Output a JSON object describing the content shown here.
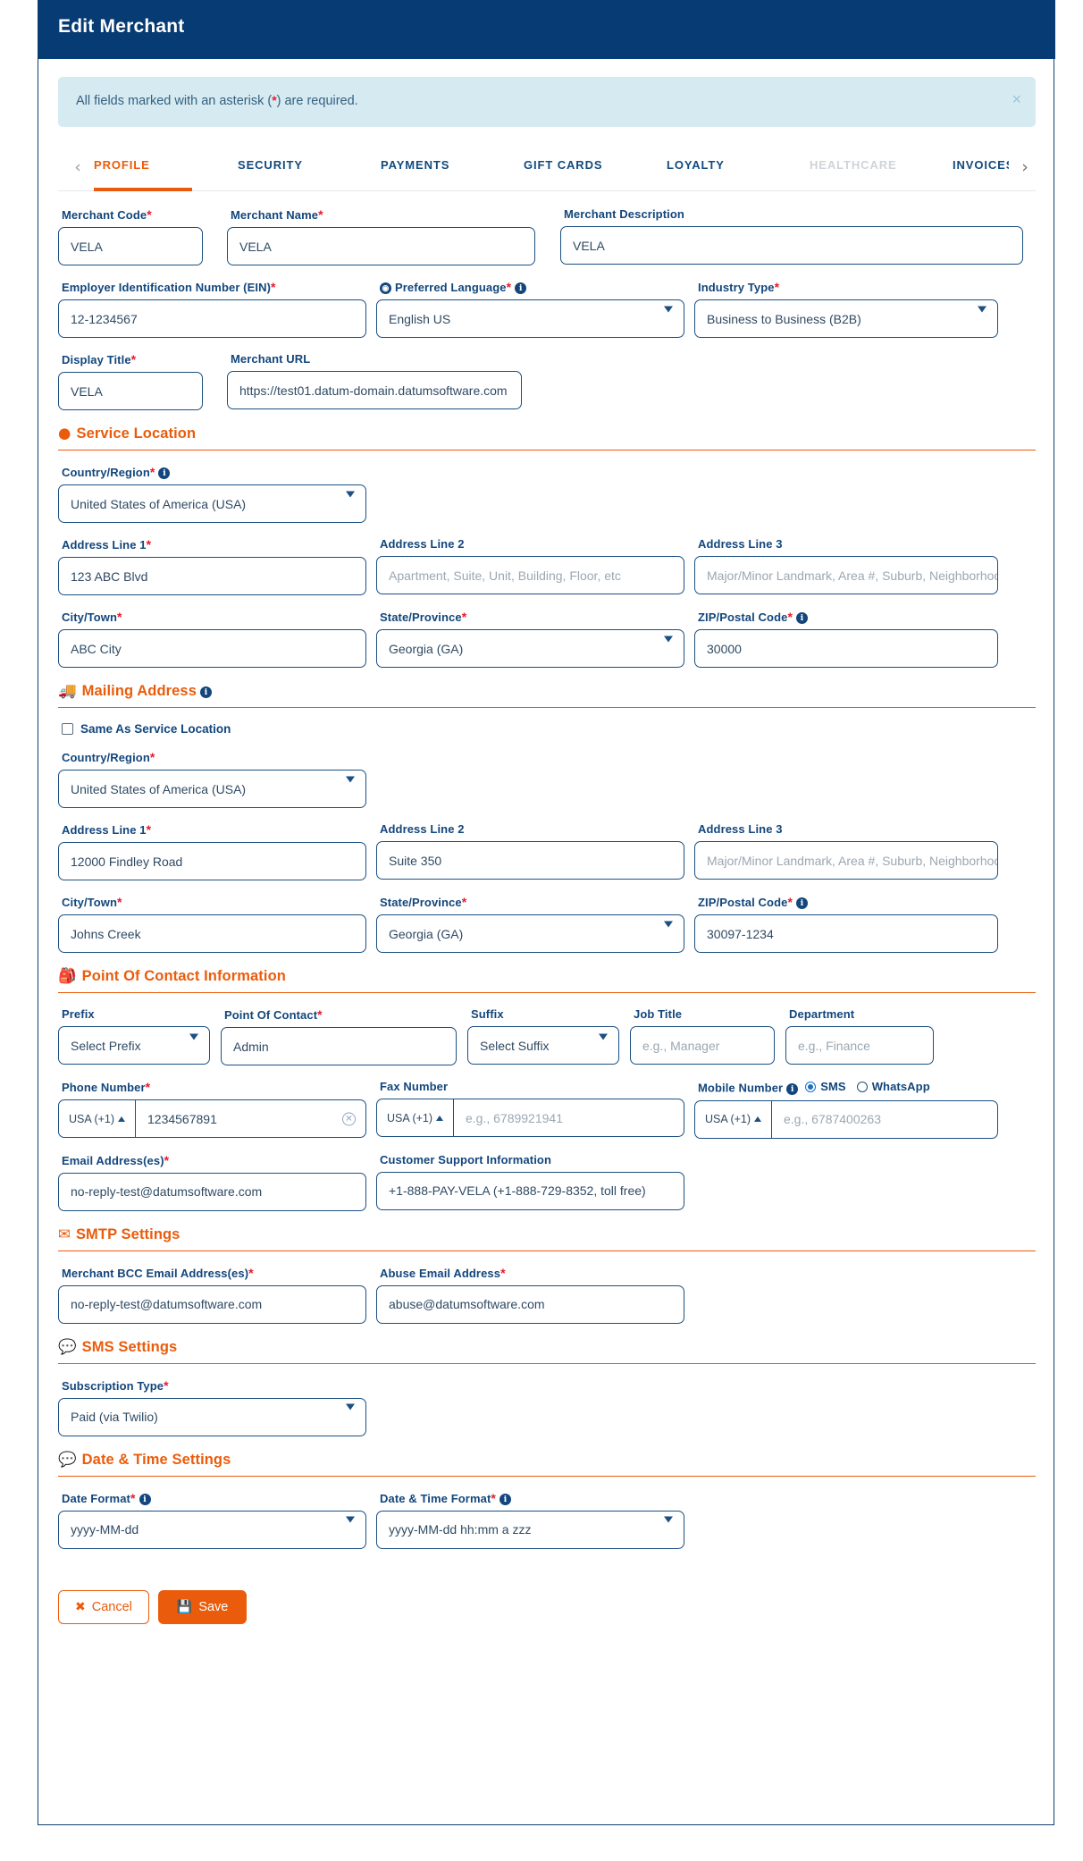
{
  "modal": {
    "title": "Edit Merchant",
    "alert": {
      "text_before": "All fields marked with an asterisk (",
      "asterisk": "*",
      "text_after": ") are required.",
      "close": "×"
    }
  },
  "tabs": {
    "prev_arrow": "‹",
    "next_arrow": "›",
    "items": [
      {
        "label": "PROFILE",
        "state": "active"
      },
      {
        "label": "SECURITY",
        "state": "normal"
      },
      {
        "label": "PAYMENTS",
        "state": "normal"
      },
      {
        "label": "GIFT CARDS",
        "state": "normal"
      },
      {
        "label": "LOYALTY",
        "state": "normal"
      },
      {
        "label": "HEALTHCARE",
        "state": "disabled"
      },
      {
        "label": "INVOICES",
        "state": "normal"
      }
    ]
  },
  "form": {
    "merchant_code": {
      "label": "Merchant Code",
      "required": true,
      "value": "VELA"
    },
    "merchant_name": {
      "label": "Merchant Name",
      "required": true,
      "value": "VELA"
    },
    "merchant_description": {
      "label": "Merchant Description",
      "required": false,
      "value": "VELA"
    },
    "ein": {
      "label": "Employer Identification Number (EIN)",
      "required": true,
      "value": "12-1234567"
    },
    "preferred_language": {
      "label": "Preferred Language",
      "required": true,
      "value": "English US",
      "has_info": true,
      "has_globe": true
    },
    "industry_type": {
      "label": "Industry Type",
      "required": true,
      "value": "Business to Business (B2B)"
    },
    "display_title": {
      "label": "Display Title",
      "required": true,
      "value": "VELA"
    },
    "merchant_url": {
      "label": "Merchant URL",
      "required": false,
      "value": "https://test01.datum-domain.datumsoftware.com"
    }
  },
  "service_location": {
    "heading": "Service Location",
    "icon": "map-pin-icon",
    "country": {
      "label": "Country/Region",
      "required": true,
      "has_info": true,
      "value": "United States of America (USA)"
    },
    "address1": {
      "label": "Address Line 1",
      "required": true,
      "value": "123 ABC Blvd"
    },
    "address2": {
      "label": "Address Line 2",
      "required": false,
      "value": "",
      "placeholder": "Apartment, Suite, Unit, Building, Floor, etc"
    },
    "address3": {
      "label": "Address Line 3",
      "required": false,
      "value": "",
      "placeholder": "Major/Minor Landmark, Area #, Suburb, Neighborhood"
    },
    "city": {
      "label": "City/Town",
      "required": true,
      "value": "ABC City"
    },
    "state": {
      "label": "State/Province",
      "required": true,
      "value": "Georgia (GA)"
    },
    "zip": {
      "label": "ZIP/Postal Code",
      "required": true,
      "has_info": true,
      "value": "30000"
    }
  },
  "mailing_address": {
    "heading": "Mailing Address",
    "icon": "truck-icon",
    "has_info": true,
    "same_as_service": {
      "label": "Same As Service Location",
      "checked": false
    },
    "country": {
      "label": "Country/Region",
      "required": true,
      "value": "United States of America (USA)"
    },
    "address1": {
      "label": "Address Line 1",
      "required": true,
      "value": "12000 Findley Road"
    },
    "address2": {
      "label": "Address Line 2",
      "required": false,
      "value": "Suite 350"
    },
    "address3": {
      "label": "Address Line 3",
      "required": false,
      "value": "",
      "placeholder": "Major/Minor Landmark, Area #, Suburb, Neighborhood"
    },
    "city": {
      "label": "City/Town",
      "required": true,
      "value": "Johns Creek"
    },
    "state": {
      "label": "State/Province",
      "required": true,
      "value": "Georgia (GA)"
    },
    "zip": {
      "label": "ZIP/Postal Code",
      "required": true,
      "has_info": true,
      "value": "30097-1234"
    }
  },
  "point_of_contact": {
    "heading": "Point Of Contact Information",
    "icon": "id-badge-icon",
    "prefix": {
      "label": "Prefix",
      "required": false,
      "value": "Select Prefix"
    },
    "contact": {
      "label": "Point Of Contact",
      "required": true,
      "value": "Admin"
    },
    "suffix": {
      "label": "Suffix",
      "required": false,
      "value": "Select Suffix"
    },
    "job_title": {
      "label": "Job Title",
      "required": false,
      "value": "",
      "placeholder": "e.g., Manager"
    },
    "department": {
      "label": "Department",
      "required": false,
      "value": "",
      "placeholder": "e.g., Finance"
    },
    "phone": {
      "label": "Phone Number",
      "required": true,
      "country_code": "USA (+1)",
      "value": "1234567891"
    },
    "fax": {
      "label": "Fax Number",
      "required": false,
      "country_code": "USA (+1)",
      "value": "",
      "placeholder": "e.g., 6789921941"
    },
    "mobile": {
      "label": "Mobile Number",
      "required": false,
      "has_info": true,
      "country_code": "USA (+1)",
      "value": "",
      "placeholder": "e.g., 6787400263",
      "options": [
        {
          "label": "SMS",
          "selected": true
        },
        {
          "label": "WhatsApp",
          "selected": false
        }
      ]
    },
    "email": {
      "label": "Email Address(es)",
      "required": true,
      "value": "no-reply-test@datumsoftware.com"
    },
    "support": {
      "label": "Customer Support Information",
      "required": false,
      "value": "+1-888-PAY-VELA (+1-888-729-8352, toll free)"
    }
  },
  "smtp_settings": {
    "heading": "SMTP Settings",
    "icon": "envelope-icon",
    "bcc": {
      "label": "Merchant BCC Email Address(es)",
      "required": true,
      "value": "no-reply-test@datumsoftware.com"
    },
    "abuse": {
      "label": "Abuse Email Address",
      "required": true,
      "value": "abuse@datumsoftware.com"
    }
  },
  "sms_settings": {
    "heading": "SMS Settings",
    "icon": "sms-bubble-icon",
    "subscription_type": {
      "label": "Subscription Type",
      "required": true,
      "value": "Paid (via Twilio)"
    }
  },
  "datetime_settings": {
    "heading": "Date & Time Settings",
    "icon": "sms-bubble-icon",
    "date_format": {
      "label": "Date Format",
      "required": true,
      "has_info": true,
      "value": "yyyy-MM-dd"
    },
    "datetime_format": {
      "label": "Date & Time Format",
      "required": true,
      "has_info": true,
      "value": "yyyy-MM-dd hh:mm a zzz"
    }
  },
  "footer": {
    "cancel": {
      "label": "Cancel",
      "icon": "✖"
    },
    "save": {
      "label": "Save",
      "icon": "💾"
    }
  },
  "colors": {
    "header_bg": "#073b73",
    "accent": "#ea5c0c",
    "label": "#12467c",
    "required": "#e8192c",
    "alert_bg": "#d6eaf2",
    "border": "#1b4f82"
  }
}
